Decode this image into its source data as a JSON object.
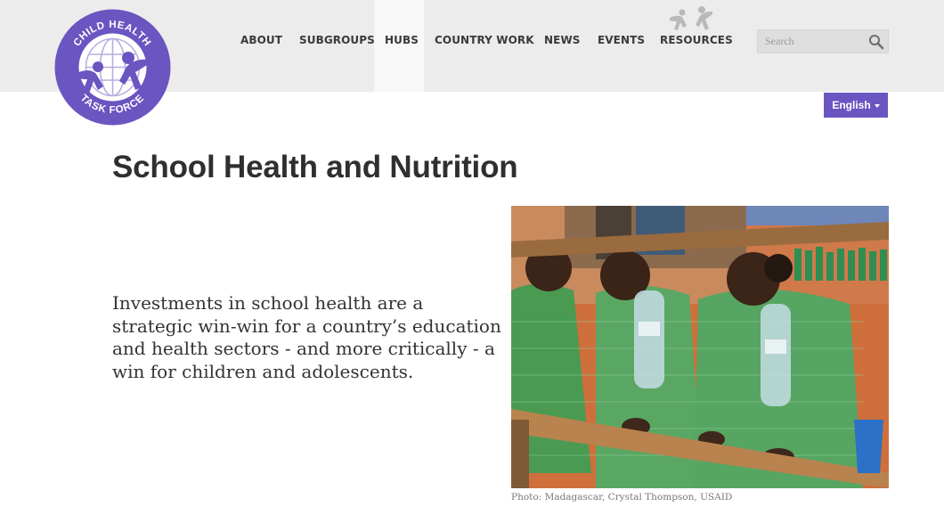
{
  "logo": {
    "line1": "CHILD HEALTH",
    "line2": "TASK FORCE",
    "ring_color": "#6a55c1",
    "icon": "globe-figures-logo"
  },
  "nav": {
    "items": [
      {
        "label": "ABOUT",
        "active": false
      },
      {
        "label": "SUBGROUPS",
        "active": false
      },
      {
        "label": "HUBS",
        "active": true
      },
      {
        "label": "COUNTRY WORK",
        "active": false
      },
      {
        "label": "NEWS",
        "active": false
      },
      {
        "label": "EVENTS",
        "active": false
      },
      {
        "label": "RESOURCES",
        "active": false,
        "icon": "people-icon"
      }
    ]
  },
  "search": {
    "placeholder": "Search",
    "icon": "search-icon"
  },
  "language": {
    "selected": "English",
    "icon": "caret-down-icon"
  },
  "page": {
    "title": "School Health and Nutrition",
    "intro": "Investments in school health are a strategic win-win for a country’s education and health sectors - and more critically - a win for children and adolescents."
  },
  "photo": {
    "caption": "Photo: Madagascar, Crystal Thompson, USAID"
  },
  "colors": {
    "accent": "#6a55c1",
    "header_bg": "#ececec",
    "title": "#2f2f2f",
    "caption": "#777777"
  }
}
